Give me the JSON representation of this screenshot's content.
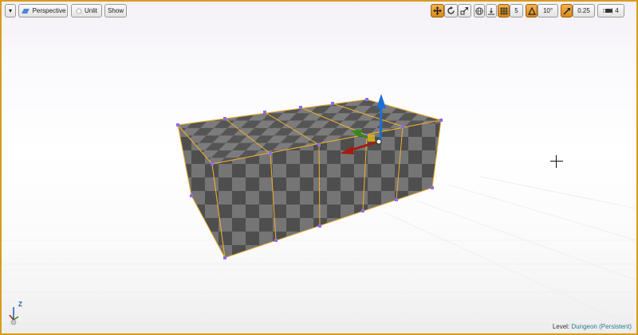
{
  "toolbar": {
    "menu_dropdown": "▾",
    "perspective_label": "Perspective",
    "unlit_label": "Unlit",
    "show_label": "Show",
    "grid_snap_value": "5",
    "rotation_snap_value": "10°",
    "scale_snap_value": "0.25",
    "camera_speed_value": "4",
    "active_tool": "translate",
    "icons": {
      "translate": "move-arrows-icon",
      "rotate": "rotate-icon",
      "scale": "scale-icon",
      "coordinate_space": "globe-icon",
      "surface_snap": "surface-snap-icon",
      "grid_snap": "grid-snap-icon",
      "rotation_snap": "rotation-snap-icon",
      "scale_snap": "scale-snap-icon",
      "camera_speed": "camera-speed-icon"
    }
  },
  "status": {
    "level_label": "Level:",
    "level_name": "Dungeon (Persistent)"
  },
  "axis_indicator": {
    "up_label": "Z"
  },
  "colors": {
    "viewport_border": "#d89c1c",
    "toggle_active": "#e39a2c",
    "selection_outline": "#f0b030",
    "vertex": "#8a6cf0",
    "mesh_dark": "#4e4e4e",
    "mesh_light": "#737373",
    "gizmo_x": "#a61b0d",
    "gizmo_y": "#2f8a16",
    "gizmo_z": "#1c6fd6",
    "level_text": "#2a7a8c"
  }
}
